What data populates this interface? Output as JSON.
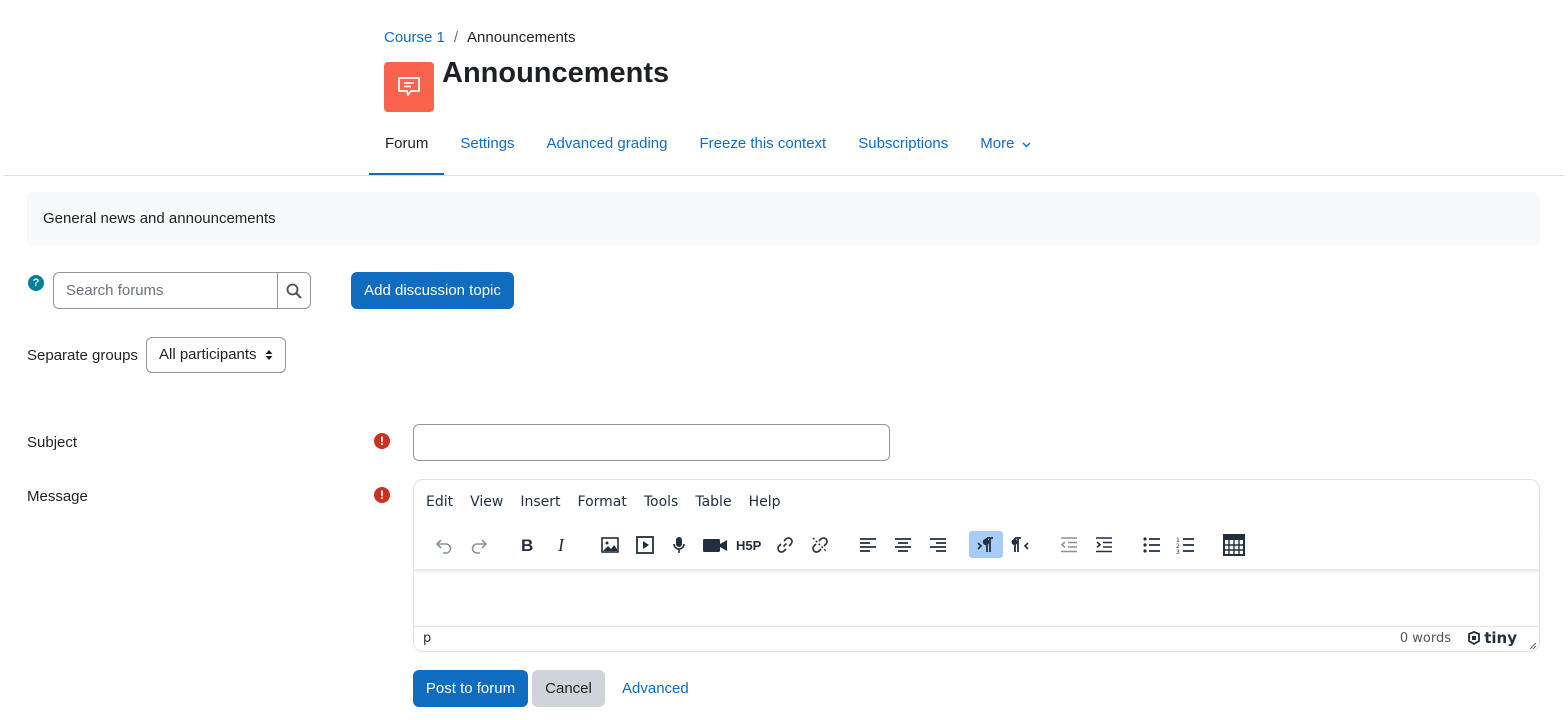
{
  "breadcrumb": {
    "course": "Course 1",
    "separator": "/",
    "current": "Announcements"
  },
  "page": {
    "title": "Announcements",
    "icon": "forum-icon",
    "icon_color": "#f7634d"
  },
  "nav": {
    "tabs": [
      {
        "label": "Forum",
        "active": true
      },
      {
        "label": "Settings"
      },
      {
        "label": "Advanced grading"
      },
      {
        "label": "Freeze this context"
      },
      {
        "label": "Subscriptions"
      },
      {
        "label": "More"
      }
    ]
  },
  "intro": {
    "text": "General news and announcements"
  },
  "search": {
    "help_glyph": "?",
    "placeholder": "Search forums"
  },
  "add_topic": {
    "label": "Add discussion topic"
  },
  "groups": {
    "label": "Separate groups",
    "selected": "All participants"
  },
  "form": {
    "subject_label": "Subject",
    "message_label": "Message",
    "required_glyph": "!"
  },
  "editor": {
    "menu": [
      "Edit",
      "View",
      "Insert",
      "Format",
      "Tools",
      "Table",
      "Help"
    ],
    "toolbar_icons": [
      "undo-icon",
      "redo-icon",
      "bold-icon",
      "italic-icon",
      "image-icon",
      "media-icon",
      "record-audio-icon",
      "record-video-icon",
      "h5p-icon",
      "link-icon",
      "unlink-icon",
      "align-left-icon",
      "align-center-icon",
      "align-right-icon",
      "ltr-icon",
      "rtl-icon",
      "outdent-icon",
      "indent-icon",
      "bullet-list-icon",
      "numbered-list-icon",
      "table-icon"
    ],
    "status_path": "p",
    "word_count": "0 words",
    "brand": "tiny"
  },
  "actions": {
    "post": "Post to forum",
    "cancel": "Cancel",
    "advanced": "Advanced"
  },
  "colors": {
    "primary": "#0f6cbf",
    "required": "#ca3120",
    "help": "#008196"
  }
}
